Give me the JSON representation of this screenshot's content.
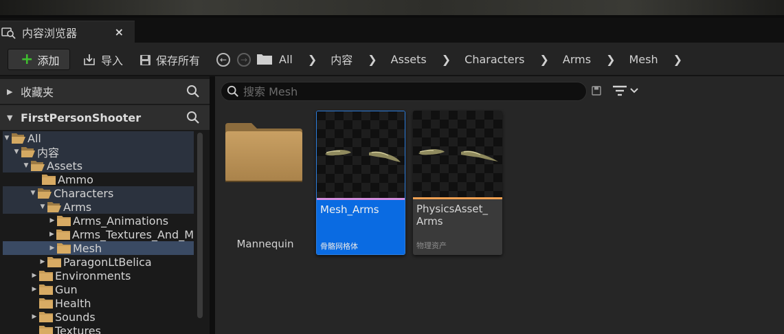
{
  "tab": {
    "title": "内容浏览器",
    "close": "×"
  },
  "toolbar": {
    "add_label": "添加",
    "import_label": "导入",
    "save_all_label": "保存所有"
  },
  "breadcrumbs": [
    "All",
    "内容",
    "Assets",
    "Characters",
    "Arms",
    "Mesh"
  ],
  "left": {
    "favorites_label": "收藏夹",
    "project_label": "FirstPersonShooter",
    "tree": [
      {
        "label": "All"
      },
      {
        "label": "内容"
      },
      {
        "label": "Assets"
      },
      {
        "label": "Ammo"
      },
      {
        "label": "Characters"
      },
      {
        "label": "Arms"
      },
      {
        "label": "Arms_Animations"
      },
      {
        "label": "Arms_Textures_And_M"
      },
      {
        "label": "Mesh"
      },
      {
        "label": "ParagonLtBelica"
      },
      {
        "label": "Environments"
      },
      {
        "label": "Gun"
      },
      {
        "label": "Health"
      },
      {
        "label": "Sounds"
      },
      {
        "label": "Textures"
      }
    ]
  },
  "content": {
    "search_placeholder": "搜索 Mesh",
    "items": [
      {
        "name": "Mannequin",
        "kind": "folder"
      },
      {
        "name": "Mesh_Arms",
        "type": "骨骼网格体",
        "selected": true,
        "accent": "#d78fe0"
      },
      {
        "name": "PhysicsAsset_\nArms",
        "type": "物理资产",
        "selected": false,
        "accent": "#f2a152"
      }
    ]
  },
  "colors": {
    "selection_blue": "#0a6be2",
    "folder": "#c19a5b",
    "add_plus": "#3fbf2f"
  }
}
